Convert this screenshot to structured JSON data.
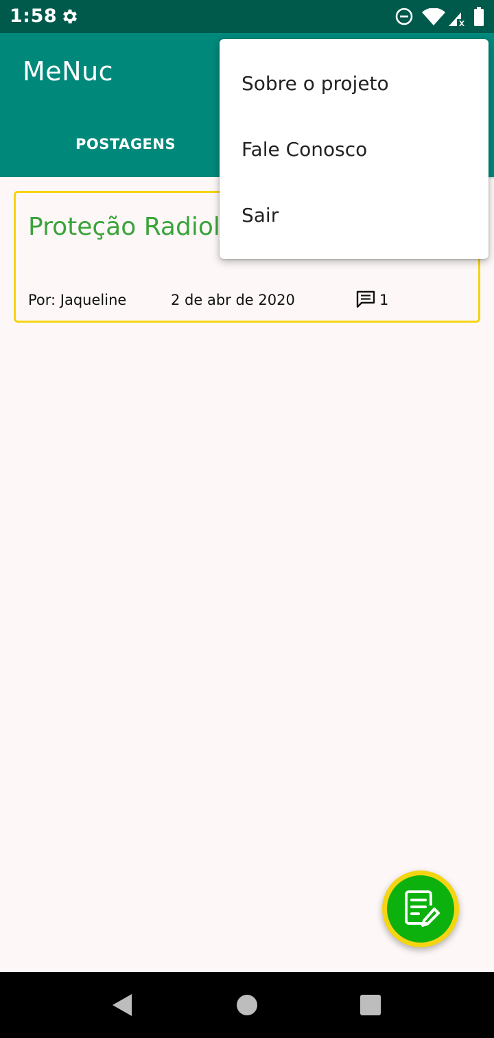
{
  "status_bar": {
    "time": "1:58",
    "icons": [
      "gear-icon",
      "do-not-disturb-icon",
      "wifi-icon",
      "signal-no-data-icon",
      "battery-icon"
    ]
  },
  "app_bar": {
    "title": "MeNuc",
    "tabs": [
      {
        "label": "POSTAGENS",
        "selected": true
      }
    ],
    "color": "#00897b"
  },
  "post": {
    "title": "Proteção Radiológica em Medicina Nuclear",
    "title_visible": "Proteção Radiol… Medicina Nuclear",
    "author": "Por: Jaqueline",
    "date": "2 de abr de 2020",
    "comment_count": "1",
    "title_color": "#3aa33a",
    "border_color": "#f5d412"
  },
  "overflow_menu": {
    "items": [
      {
        "label": "Sobre o projeto"
      },
      {
        "label": "Fale Conosco"
      },
      {
        "label": "Sair"
      }
    ]
  },
  "fab": {
    "icon": "edit-document-icon",
    "color": "#0db10d",
    "ring_color": "#f5d412"
  },
  "nav_bar": {
    "icons": [
      "back-icon",
      "home-icon",
      "recents-icon"
    ]
  }
}
